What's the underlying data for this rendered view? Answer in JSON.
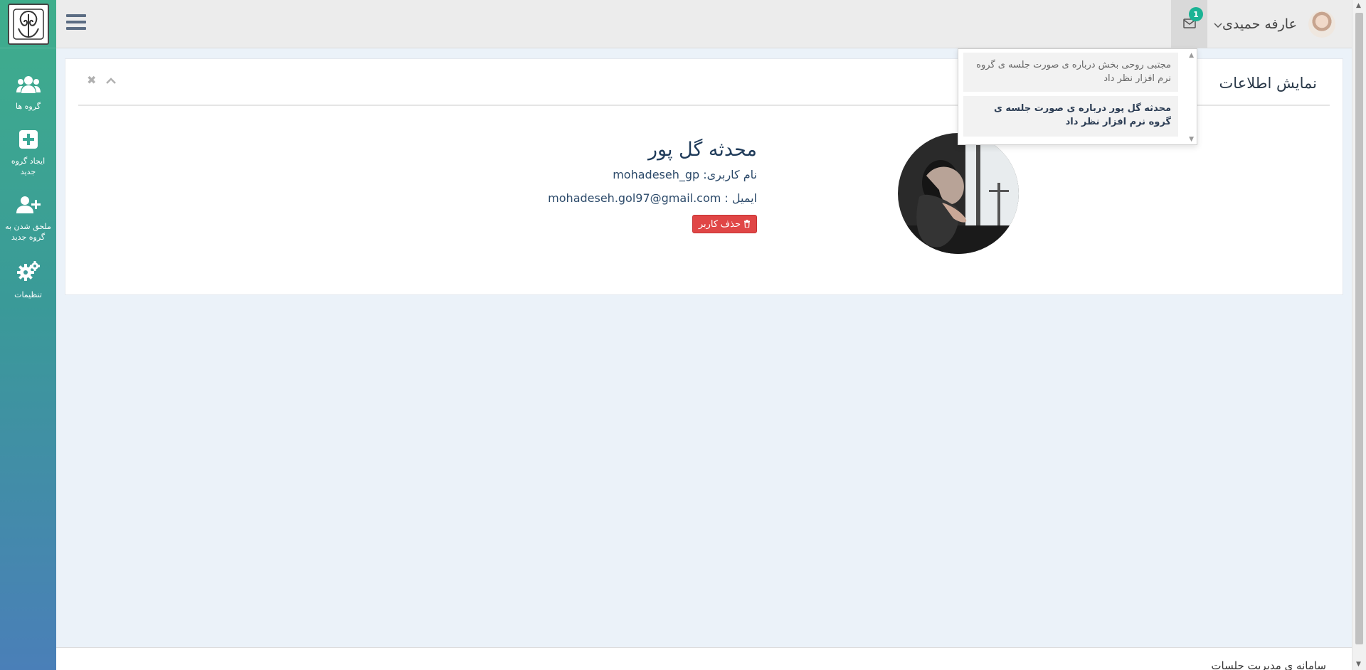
{
  "sidebar": {
    "logo_icon": "ornament-logo-icon",
    "items": [
      {
        "label": "گروه ها",
        "icon": "users-icon"
      },
      {
        "label": "ایجاد گروه جدید",
        "icon": "plus-square-icon"
      },
      {
        "label": "ملحق شدن به گروه جدید",
        "icon": "user-plus-icon"
      },
      {
        "label": "تنظیمات",
        "icon": "gears-icon"
      }
    ]
  },
  "topbar": {
    "menu_icon": "hamburger-icon",
    "mail_icon": "envelope-icon",
    "notification_count": "1",
    "user_name": "عارفه حمیدی",
    "user_chevron": "chevron-down-icon"
  },
  "panel": {
    "title": "نمایش اطلاعات",
    "collapse_icon": "chevron-up-icon",
    "close_icon": "close-icon"
  },
  "profile": {
    "name": "محدثه گل پور",
    "username_line": "نام کاربری: mohadeseh_gp",
    "email_line": "ایمیل : mohadeseh.gol97@gmail.com",
    "delete_label": "حذف کاربر",
    "delete_icon": "trash-icon"
  },
  "notifications": [
    {
      "text": "مجتبی روحی بخش درباره ی صورت جلسه ی گروه نرم افزار نظر داد",
      "status": "read"
    },
    {
      "text": "محدثه گل پور درباره ی صورت جلسه ی گروه نرم افزار نظر داد",
      "status": "unread"
    }
  ],
  "footer": {
    "text": "سامانه ی مدیریت جلسات"
  },
  "colors": {
    "accent": "#1ab394",
    "danger": "#e04646",
    "sidebar_top": "#3fae8c",
    "sidebar_bottom": "#4a7fb8"
  }
}
